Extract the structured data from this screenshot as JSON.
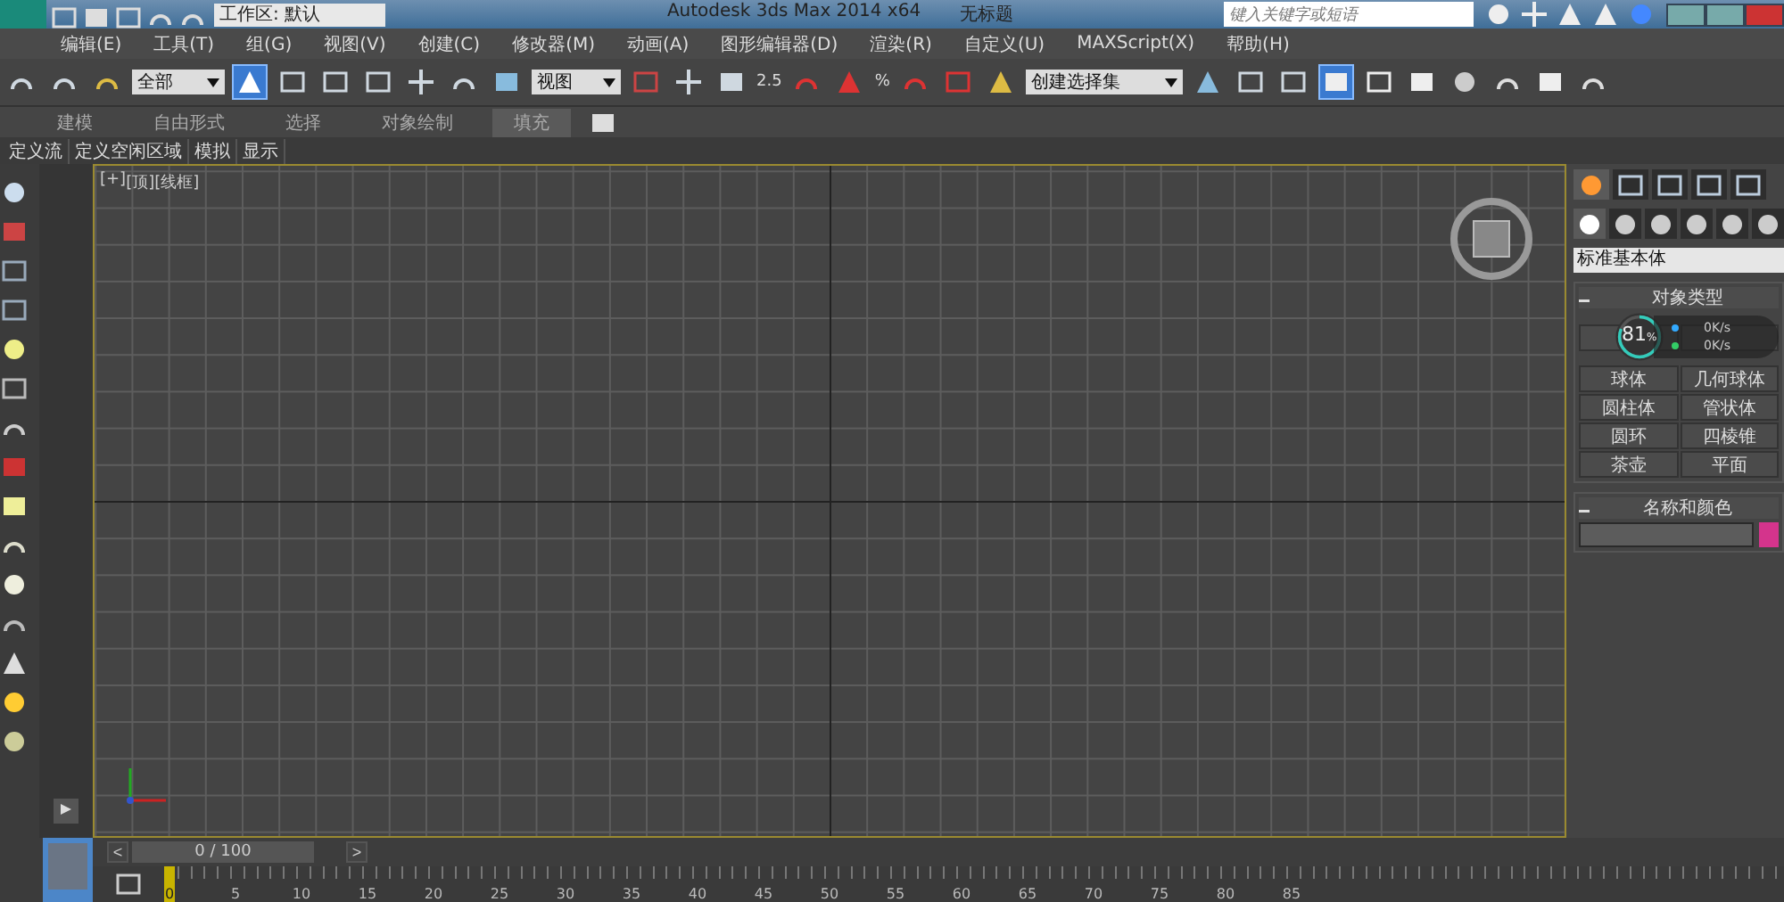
{
  "title_bar": {
    "workspace": "工作区: 默认",
    "app_title": "Autodesk 3ds Max  2014 x64",
    "document": "无标题",
    "search": {
      "placeholder": "键入关键字或短语"
    }
  },
  "menu": [
    "编辑(E)",
    "工具(T)",
    "组(G)",
    "视图(V)",
    "创建(C)",
    "修改器(M)",
    "动画(A)",
    "图形编辑器(D)",
    "渲染(R)",
    "自定义(U)",
    "MAXScript(X)",
    "帮助(H)"
  ],
  "toolbar": {
    "selection_filter": "全部",
    "coordinate_system": "视图",
    "snap_angle": "2.5",
    "snap_percent": "%",
    "named_selection": "创建选择集"
  },
  "ribbon_tabs": [
    {
      "label": "建模",
      "selected": false
    },
    {
      "label": "自由形式",
      "selected": false
    },
    {
      "label": "选择",
      "selected": false
    },
    {
      "label": "对象绘制",
      "selected": false
    },
    {
      "label": "填充",
      "selected": true
    }
  ],
  "ribbon_subtabs": [
    "定义流",
    "定义空闲区域",
    "模拟",
    "显示"
  ],
  "viewport": {
    "labels": [
      "[+]",
      "[顶]",
      "[线框]"
    ]
  },
  "command_panel": {
    "panel_tabs": [
      {
        "selected": true
      },
      {
        "selected": false
      },
      {
        "selected": false
      },
      {
        "selected": false
      },
      {
        "selected": false
      }
    ],
    "category_tabs": [
      {
        "selected": true
      },
      {
        "selected": false
      },
      {
        "selected": false
      },
      {
        "selected": false
      },
      {
        "selected": false
      },
      {
        "selected": false
      }
    ],
    "category": "标准基本体",
    "object_type": {
      "title": "对象类型",
      "buttons": [
        "球体",
        "几何球体",
        "圆柱体",
        "管状体",
        "圆环",
        "四棱锥",
        "茶壶",
        "平面"
      ]
    },
    "name_color": {
      "title": "名称和颜色",
      "color": "#d4348c"
    }
  },
  "net_monitor": {
    "percent": "81",
    "unit": "%",
    "level": 0.81,
    "upload": "0K/s",
    "download": "0K/s"
  },
  "time_slider": {
    "prev": "<",
    "position": "0 / 100",
    "level": 0,
    "next": ">"
  },
  "ruler": [
    "0",
    "5",
    "10",
    "15",
    "20",
    "25",
    "30",
    "35",
    "40",
    "45",
    "50",
    "55",
    "60",
    "65",
    "70",
    "75",
    "80",
    "85"
  ]
}
